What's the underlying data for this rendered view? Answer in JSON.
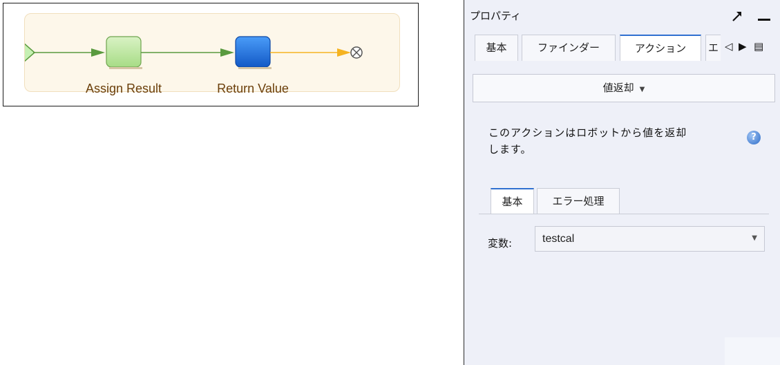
{
  "workflow": {
    "steps": [
      {
        "label": "Assign Result",
        "color": "#a7dc86"
      },
      {
        "label": "Return Value",
        "color": "#1d6fe3"
      }
    ],
    "colors": {
      "green_connector": "#5a9a3f",
      "orange_connector": "#f5b321",
      "area_background": "#fdf7ea"
    },
    "icons": [
      "start-arrow-icon",
      "end-cancel-icon"
    ]
  },
  "properties": {
    "title": "プロパティ",
    "icons": [
      "pin-icon",
      "minimize-icon"
    ],
    "tabs": [
      {
        "label": "基本"
      },
      {
        "label": "ファインダー"
      },
      {
        "label": "アクション"
      },
      {
        "label": "エ"
      }
    ],
    "active_tab": "アクション",
    "tab_nav": {
      "left": "◁",
      "right": "▶",
      "list": "▤"
    },
    "action_dropdown": {
      "label": "値返却",
      "caret": "▼"
    },
    "description": {
      "line1": "このアクションはロボットから値を返却",
      "line2": "します。"
    },
    "help_icon": "?",
    "sub_tabs": [
      {
        "label": "基本"
      },
      {
        "label": "エラー処理"
      }
    ],
    "active_sub_tab": "基本",
    "variable": {
      "label": "変数:",
      "value": "testcal",
      "caret": "▼"
    },
    "accent_color": "#2f6fd0"
  }
}
